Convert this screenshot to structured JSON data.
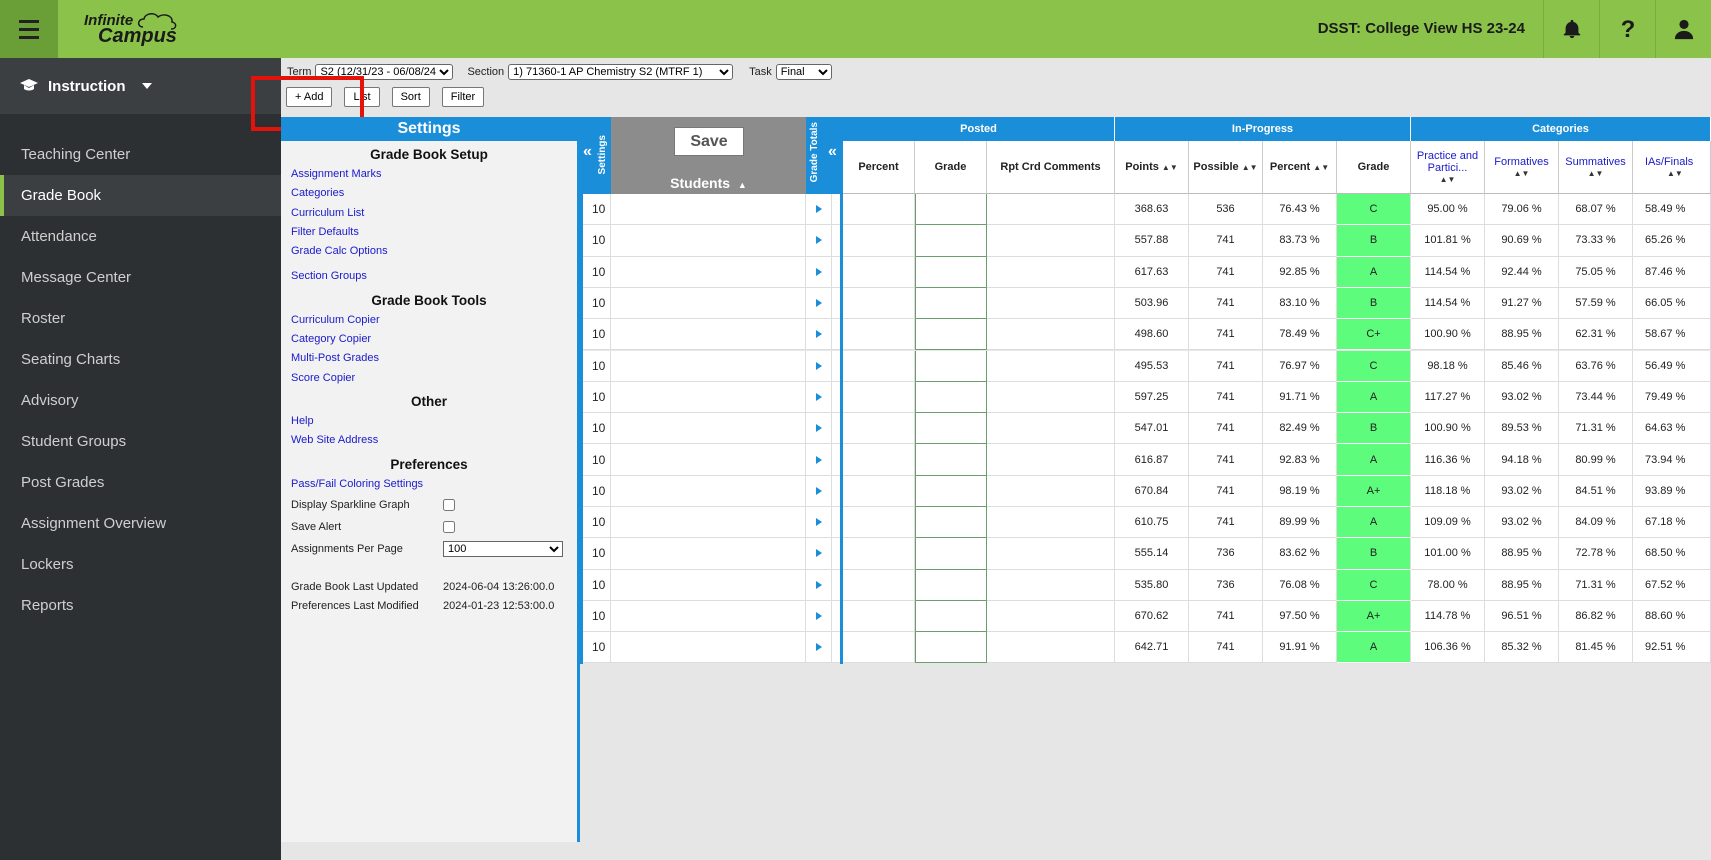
{
  "header": {
    "logo_line1": "Infinite",
    "logo_line2": "Campus",
    "school": "DSST: College View HS 23-24"
  },
  "sidebar": {
    "section": "Instruction",
    "items": [
      {
        "label": "Teaching Center",
        "active": false
      },
      {
        "label": "Grade Book",
        "active": true
      },
      {
        "label": "Attendance",
        "active": false
      },
      {
        "label": "Message Center",
        "active": false
      },
      {
        "label": "Roster",
        "active": false
      },
      {
        "label": "Seating Charts",
        "active": false
      },
      {
        "label": "Advisory",
        "active": false
      },
      {
        "label": "Student Groups",
        "active": false
      },
      {
        "label": "Post Grades",
        "active": false
      },
      {
        "label": "Assignment Overview",
        "active": false
      },
      {
        "label": "Lockers",
        "active": false
      },
      {
        "label": "Reports",
        "active": false
      }
    ]
  },
  "toolbar": {
    "term_label": "Term",
    "term_value": "S2 (12/31/23 - 06/08/24)",
    "section_label": "Section",
    "section_value": "1) 71360-1 AP Chemistry S2 (MTRF 1)",
    "task_label": "Task",
    "task_value": "Final",
    "add_label": "+ Add",
    "list_label": "List",
    "sort_label": "Sort",
    "filter_label": "Filter"
  },
  "settings": {
    "title": "Settings",
    "setup_title": "Grade Book Setup",
    "setup_links": [
      "Assignment Marks",
      "Categories",
      "Curriculum List",
      "Filter Defaults",
      "Grade Calc Options"
    ],
    "section_groups": "Section Groups",
    "tools_title": "Grade Book Tools",
    "tools_links": [
      "Curriculum Copier",
      "Category Copier",
      "Multi-Post Grades",
      "Score Copier"
    ],
    "other_title": "Other",
    "other_links": [
      "Help",
      "Web Site Address"
    ],
    "prefs_title": "Preferences",
    "pref_link": "Pass/Fail Coloring Settings",
    "sparkline_label": "Display Sparkline Graph",
    "save_alert_label": "Save Alert",
    "per_page_label": "Assignments Per Page",
    "per_page_value": "100",
    "last_updated_label": "Grade Book Last Updated",
    "last_updated_value": "2024-06-04 13:26:00.0",
    "prefs_modified_label": "Preferences Last Modified",
    "prefs_modified_value": "2024-01-23 12:53:00.0"
  },
  "grid": {
    "tab_settings": "Settings",
    "tab_totals": "Grade Totals",
    "save_label": "Save",
    "students_label": "Students",
    "groups": {
      "posted": "Posted",
      "inprogress": "In-Progress",
      "categories": "Categories"
    },
    "columns": {
      "percent": "Percent",
      "grade": "Grade",
      "rpt": "Rpt Crd Comments",
      "points": "Points",
      "possible": "Possible",
      "ip_percent": "Percent",
      "ip_grade": "Grade",
      "practice": "Practice and Partici...",
      "formatives": "Formatives",
      "summatives": "Summatives",
      "ias": "IAs/Finals"
    },
    "rows": [
      {
        "num": "10",
        "points": "368.63",
        "possible": "536",
        "percent": "76.43 %",
        "grade": "C",
        "c1": "95.00 %",
        "c2": "79.06 %",
        "c3": "68.07 %",
        "c4": "58.49 %"
      },
      {
        "num": "10",
        "points": "557.88",
        "possible": "741",
        "percent": "83.73 %",
        "grade": "B",
        "c1": "101.81 %",
        "c2": "90.69 %",
        "c3": "73.33 %",
        "c4": "65.26 %"
      },
      {
        "num": "10",
        "points": "617.63",
        "possible": "741",
        "percent": "92.85 %",
        "grade": "A",
        "c1": "114.54 %",
        "c2": "92.44 %",
        "c3": "75.05 %",
        "c4": "87.46 %"
      },
      {
        "num": "10",
        "points": "503.96",
        "possible": "741",
        "percent": "83.10 %",
        "grade": "B",
        "c1": "114.54 %",
        "c2": "91.27 %",
        "c3": "57.59 %",
        "c4": "66.05 %"
      },
      {
        "num": "10",
        "points": "498.60",
        "possible": "741",
        "percent": "78.49 %",
        "grade": "C+",
        "c1": "100.90 %",
        "c2": "88.95 %",
        "c3": "62.31 %",
        "c4": "58.67 %"
      },
      {
        "num": "10",
        "points": "495.53",
        "possible": "741",
        "percent": "76.97 %",
        "grade": "C",
        "c1": "98.18 %",
        "c2": "85.46 %",
        "c3": "63.76 %",
        "c4": "56.49 %"
      },
      {
        "num": "10",
        "points": "597.25",
        "possible": "741",
        "percent": "91.71 %",
        "grade": "A",
        "c1": "117.27 %",
        "c2": "93.02 %",
        "c3": "73.44 %",
        "c4": "79.49 %"
      },
      {
        "num": "10",
        "points": "547.01",
        "possible": "741",
        "percent": "82.49 %",
        "grade": "B",
        "c1": "100.90 %",
        "c2": "89.53 %",
        "c3": "71.31 %",
        "c4": "64.63 %"
      },
      {
        "num": "10",
        "points": "616.87",
        "possible": "741",
        "percent": "92.83 %",
        "grade": "A",
        "c1": "116.36 %",
        "c2": "94.18 %",
        "c3": "80.99 %",
        "c4": "73.94 %"
      },
      {
        "num": "10",
        "points": "670.84",
        "possible": "741",
        "percent": "98.19 %",
        "grade": "A+",
        "c1": "118.18 %",
        "c2": "93.02 %",
        "c3": "84.51 %",
        "c4": "93.89 %"
      },
      {
        "num": "10",
        "points": "610.75",
        "possible": "741",
        "percent": "89.99 %",
        "grade": "A",
        "c1": "109.09 %",
        "c2": "93.02 %",
        "c3": "84.09 %",
        "c4": "67.18 %"
      },
      {
        "num": "10",
        "points": "555.14",
        "possible": "736",
        "percent": "83.62 %",
        "grade": "B",
        "c1": "101.00 %",
        "c2": "88.95 %",
        "c3": "72.78 %",
        "c4": "68.50 %"
      },
      {
        "num": "10",
        "points": "535.80",
        "possible": "736",
        "percent": "76.08 %",
        "grade": "C",
        "c1": "78.00 %",
        "c2": "88.95 %",
        "c3": "71.31 %",
        "c4": "67.52 %"
      },
      {
        "num": "10",
        "points": "670.62",
        "possible": "741",
        "percent": "97.50 %",
        "grade": "A+",
        "c1": "114.78 %",
        "c2": "96.51 %",
        "c3": "86.82 %",
        "c4": "88.60 %"
      },
      {
        "num": "10",
        "points": "642.71",
        "possible": "741",
        "percent": "91.91 %",
        "grade": "A",
        "c1": "106.36 %",
        "c2": "85.32 %",
        "c3": "81.45 %",
        "c4": "92.51 %"
      }
    ]
  },
  "colors": {
    "accent": "#8bc34a",
    "blue": "#1a8ed8",
    "grade_green": "#5dfc7d",
    "highlight": "#e3120b"
  }
}
